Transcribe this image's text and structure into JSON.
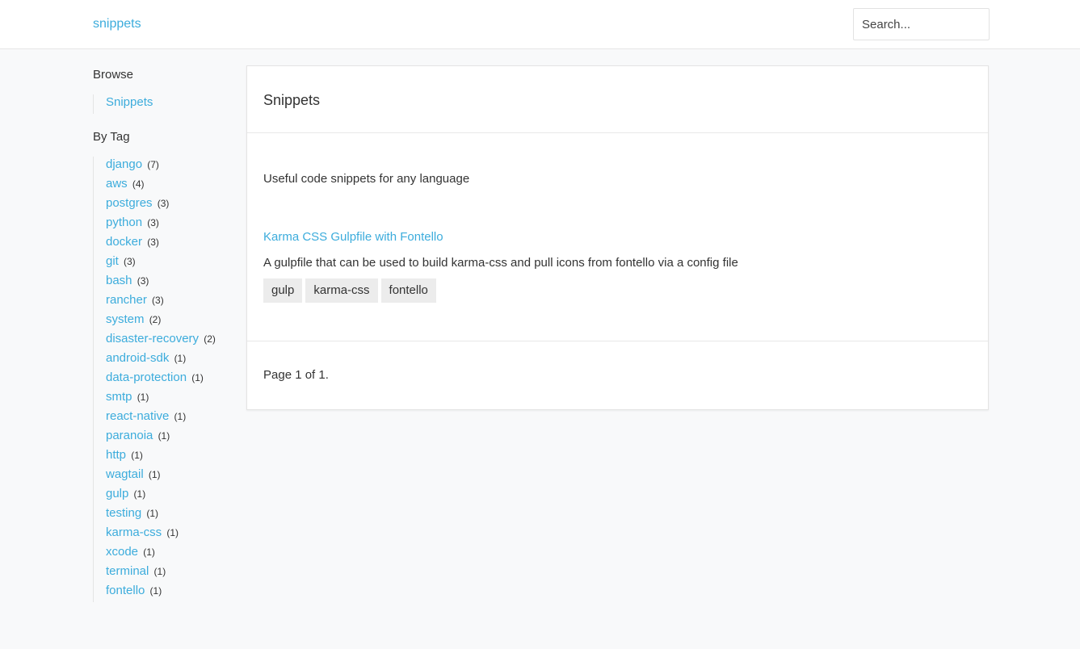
{
  "header": {
    "brand": "snippets",
    "search_placeholder": "Search..."
  },
  "sidebar": {
    "browse_heading": "Browse",
    "browse_items": [
      {
        "label": "Snippets"
      }
    ],
    "tag_heading": "By Tag",
    "tags": [
      {
        "label": "django",
        "count": "(7)"
      },
      {
        "label": "aws",
        "count": "(4)"
      },
      {
        "label": "postgres",
        "count": "(3)"
      },
      {
        "label": "python",
        "count": "(3)"
      },
      {
        "label": "docker",
        "count": "(3)"
      },
      {
        "label": "git",
        "count": "(3)"
      },
      {
        "label": "bash",
        "count": "(3)"
      },
      {
        "label": "rancher",
        "count": "(3)"
      },
      {
        "label": "system",
        "count": "(2)"
      },
      {
        "label": "disaster-recovery",
        "count": "(2)"
      },
      {
        "label": "android-sdk",
        "count": "(1)"
      },
      {
        "label": "data-protection",
        "count": "(1)"
      },
      {
        "label": "smtp",
        "count": "(1)"
      },
      {
        "label": "react-native",
        "count": "(1)"
      },
      {
        "label": "paranoia",
        "count": "(1)"
      },
      {
        "label": "http",
        "count": "(1)"
      },
      {
        "label": "wagtail",
        "count": "(1)"
      },
      {
        "label": "gulp",
        "count": "(1)"
      },
      {
        "label": "testing",
        "count": "(1)"
      },
      {
        "label": "karma-css",
        "count": "(1)"
      },
      {
        "label": "xcode",
        "count": "(1)"
      },
      {
        "label": "terminal",
        "count": "(1)"
      },
      {
        "label": "fontello",
        "count": "(1)"
      }
    ]
  },
  "main": {
    "title": "Snippets",
    "description": "Useful code snippets for any language",
    "snippets": [
      {
        "title": "Karma CSS Gulpfile with Fontello",
        "description": "A gulpfile that can be used to build karma-css and pull icons from fontello via a config file",
        "tags": [
          "gulp",
          "karma-css",
          "fontello"
        ]
      }
    ],
    "pagination": "Page 1 of 1."
  },
  "colors": {
    "link": "#3cacdc",
    "background": "#f8f9fa",
    "card": "#ffffff",
    "tag_bg": "#ececec"
  }
}
